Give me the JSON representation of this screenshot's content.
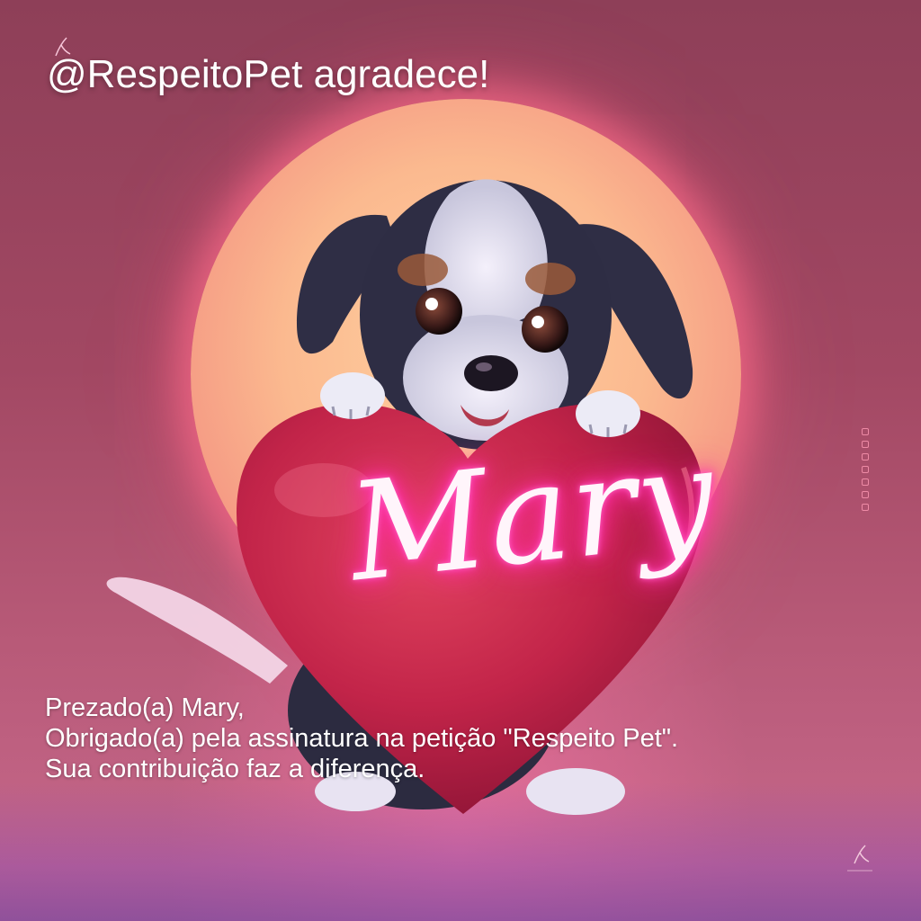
{
  "header": {
    "title": "@RespeitoPet agradece!"
  },
  "heart": {
    "name": "Mary"
  },
  "message": {
    "lines": [
      "Prezado(a) Mary,",
      "Obrigado(a) pela assinatura na petição \"Respeito Pet\".",
      "Sua contribuição faz a diferença."
    ]
  },
  "image": {
    "subject": "puppy-holding-heart-icon"
  },
  "colors": {
    "heart": "#c8284e",
    "neon": "#ff3ab0",
    "sun": "#fbb98f",
    "background": "#a24863"
  }
}
